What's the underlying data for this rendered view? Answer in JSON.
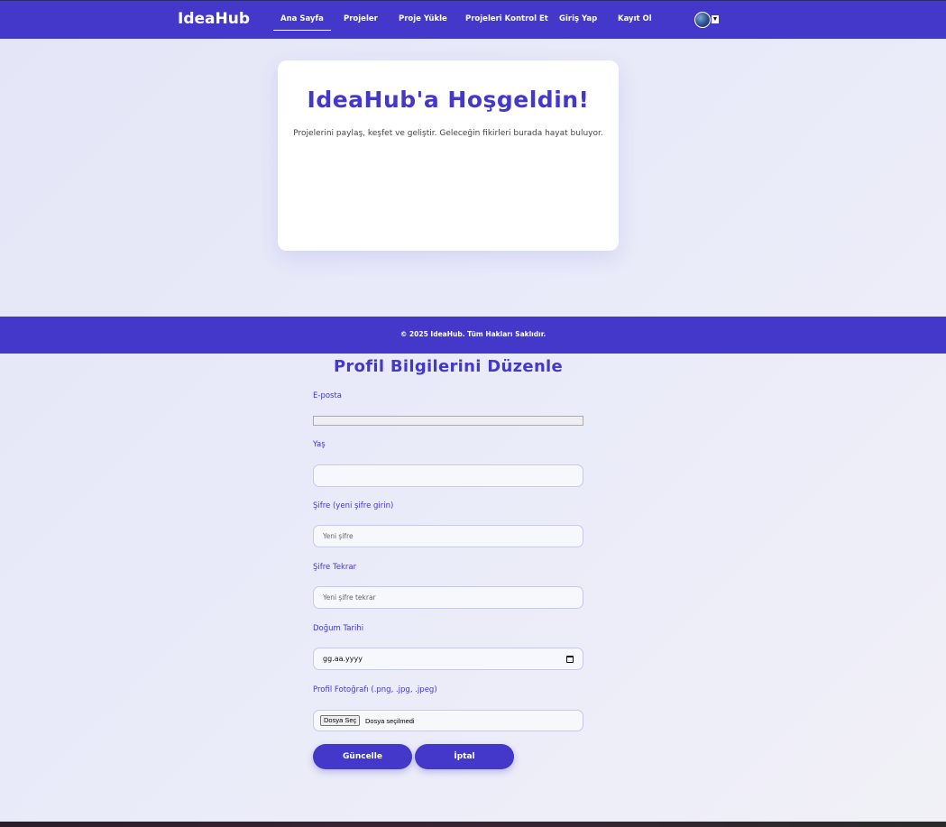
{
  "nav": {
    "brand": "IdeaHub",
    "items": [
      {
        "label": "Ana Sayfa"
      },
      {
        "label": "Projeler"
      },
      {
        "label": "Proje Yükle"
      },
      {
        "label": "Projeleri Kontrol Et"
      },
      {
        "label": "Giriş Yap"
      },
      {
        "label": "Kayıt Ol"
      }
    ]
  },
  "hero": {
    "title": "IdeaHub'a Hoşgeldin!",
    "text": "Projelerini paylaş, keşfet ve geliştir. Geleceğin fikirleri burada hayat buluyor."
  },
  "footer": {
    "text": "© 2025 IdeaHub. Tüm Hakları Saklıdır."
  },
  "form": {
    "title": "Profil Bilgilerini Düzenle",
    "email_label": "E-posta",
    "email_value": "",
    "age_label": "Yaş",
    "age_value": "",
    "password_label": "Şifre (yeni şifre girin)",
    "password_placeholder": "Yeni şifre",
    "password_repeat_label": "Şifre Tekrar",
    "password_repeat_placeholder": "Yeni şifre tekrar",
    "birthdate_label": "Doğum Tarihi",
    "birthdate_placeholder": "gg.aa.yyyy",
    "photo_label": "Profil Fotoğrafı (.png, .jpg, .jpeg)",
    "file_button": "Dosya Seç",
    "file_status": "Dosya seçilmedi",
    "update_button": "Güncelle",
    "cancel_button": "İptal"
  },
  "colors": {
    "accent": "#4338ca"
  }
}
